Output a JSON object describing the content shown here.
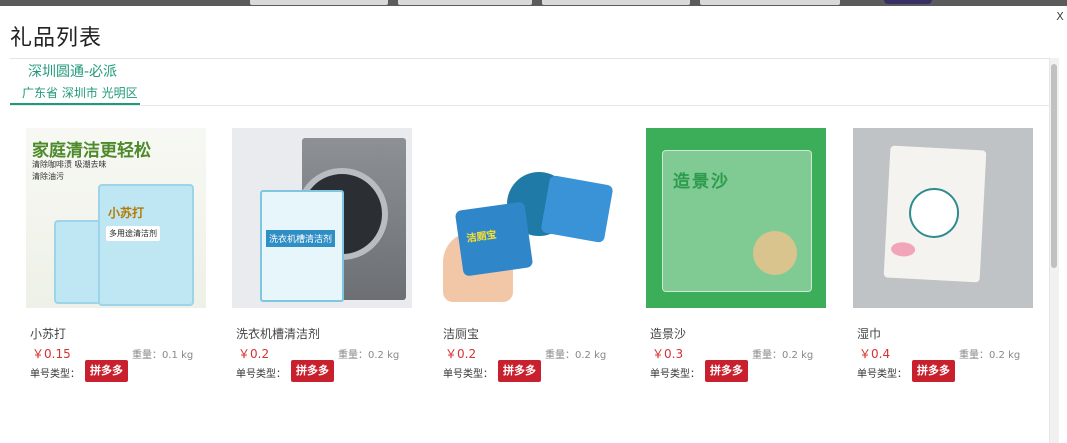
{
  "modal": {
    "title": "礼品列表",
    "close_label": "X"
  },
  "shop": {
    "name": "深圳圆通-必派",
    "region_tab": "广东省 深圳市 光明区"
  },
  "colors": {
    "accent": "#1f9a7a",
    "price": "#d63232",
    "badge": "#c9202e"
  },
  "products": [
    {
      "name": "小苏打",
      "price": "￥0.15",
      "weight": "重量：0.1 kg",
      "type_label": "单号类型：",
      "badge": "拼多多",
      "art": {
        "headline": "家庭清洁更轻松",
        "sub1": "清除咖啡渍 吸潮去味",
        "sub2": "清除油污",
        "pack_label": "小苏打",
        "pack_sub": "多用途清洁剂"
      }
    },
    {
      "name": "洗衣机槽清洁剂",
      "price": "￥0.2",
      "weight": "重量：0.2 kg",
      "type_label": "单号类型：",
      "badge": "拼多多",
      "art": {
        "pack_label": "洗衣机槽清洁剂"
      }
    },
    {
      "name": "洁厕宝",
      "price": "￥0.2",
      "weight": "重量：0.2 kg",
      "type_label": "单号类型：",
      "badge": "拼多多",
      "art": {
        "pack_label": "洁厕宝"
      }
    },
    {
      "name": "造景沙",
      "price": "￥0.3",
      "weight": "重量：0.2 kg",
      "type_label": "单号类型：",
      "badge": "拼多多",
      "art": {
        "pack_label": "造景沙"
      }
    },
    {
      "name": "湿巾",
      "price": "￥0.4",
      "weight": "重量：0.2 kg",
      "type_label": "单号类型：",
      "badge": "拼多多",
      "art": {}
    }
  ]
}
